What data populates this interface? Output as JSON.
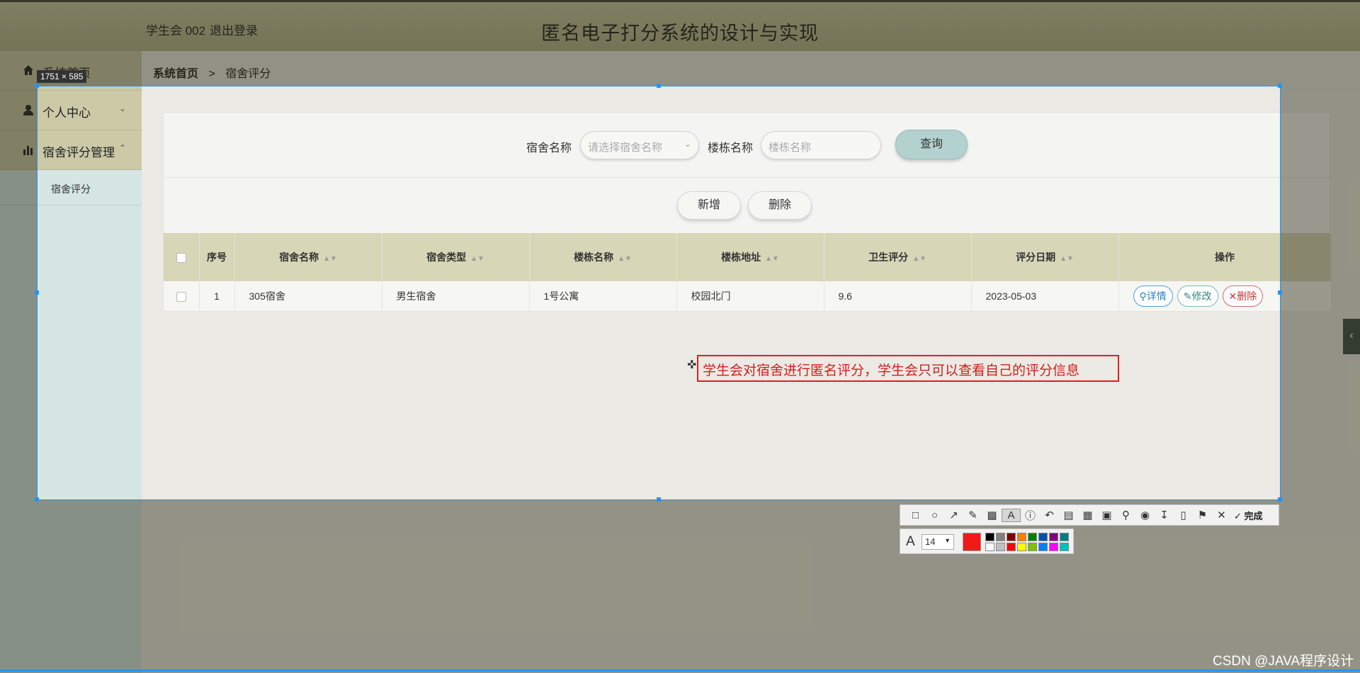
{
  "header": {
    "user": "学生会 002",
    "logout": "退出登录",
    "title": "匿名电子打分系统的设计与实现"
  },
  "sidebar": {
    "items": [
      {
        "label": "系统首页",
        "icon": "home-icon"
      },
      {
        "label": "个人中心",
        "icon": "user-icon"
      },
      {
        "label": "宿舍评分管理",
        "icon": "bar-chart-icon"
      }
    ],
    "sub_items": [
      {
        "label": "宿舍评分"
      }
    ]
  },
  "breadcrumb": {
    "home": "系统首页",
    "separator": ">",
    "current": "宿舍评分"
  },
  "search": {
    "dorm_label": "宿舍名称",
    "dorm_placeholder": "请选择宿舍名称",
    "building_label": "楼栋名称",
    "building_placeholder": "楼栋名称",
    "query_button": "查询"
  },
  "actions": {
    "add": "新增",
    "delete": "删除"
  },
  "table": {
    "columns": [
      "序号",
      "宿舍名称",
      "宿舍类型",
      "楼栋名称",
      "楼栋地址",
      "卫生评分",
      "评分日期",
      "操作"
    ],
    "rows": [
      [
        "1",
        "305宿舍",
        "男生宿舍",
        "1号公寓",
        "校园北门",
        "9.6",
        "2023-05-03"
      ]
    ],
    "row_actions": {
      "detail": "详情",
      "edit": "修改",
      "delete": "删除"
    }
  },
  "overlay": {
    "size_label": "1751 × 585",
    "annotation": "学生会对宿舍进行匿名评分，学生会只可以查看自己的评分信息",
    "done_label": "完成",
    "font_size": "14",
    "current_color": "#f01a1a",
    "palette": [
      "#000000",
      "#808080",
      "#800000",
      "#ff8000",
      "#008000",
      "#0050b0",
      "#800080",
      "#008080",
      "#ffffff",
      "#c0c0c0",
      "#ff0000",
      "#ffff00",
      "#80c000",
      "#0080ff",
      "#ff00ff",
      "#00c0c0"
    ]
  },
  "watermark": "CSDN @JAVA程序设计"
}
